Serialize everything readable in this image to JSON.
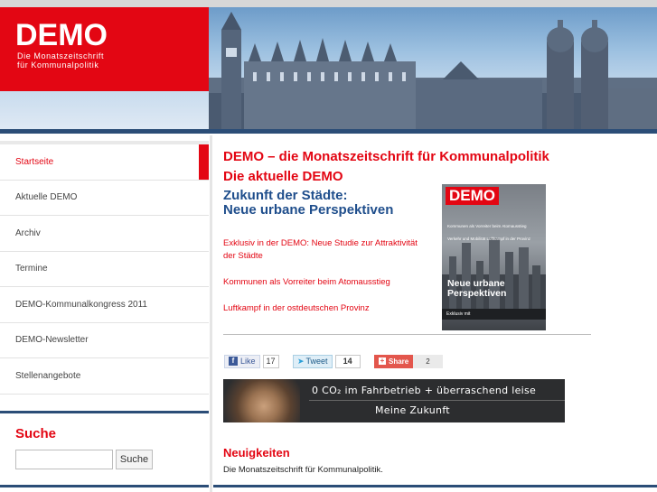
{
  "header": {
    "logo_title": "DEMO",
    "logo_subtitle_1": "Die Monatszeitschrift",
    "logo_subtitle_2": "für Kommunalpolitik"
  },
  "sidebar": {
    "items": [
      {
        "label": "Startseite",
        "active": true
      },
      {
        "label": "Aktuelle DEMO",
        "active": false
      },
      {
        "label": "Archiv",
        "active": false
      },
      {
        "label": "Termine",
        "active": false
      },
      {
        "label": "DEMO-Kommunalkongress 2011",
        "active": false
      },
      {
        "label": "DEMO-Newsletter",
        "active": false
      },
      {
        "label": "Stellenangebote",
        "active": false
      }
    ],
    "search": {
      "title": "Suche",
      "input_value": "",
      "button_label": "Suche"
    }
  },
  "main": {
    "title": "DEMO – die Monatszeitschrift für Kommunalpolitik",
    "subtitle": "Die aktuelle DEMO",
    "headline_1": "Zukunft der Städte:",
    "headline_2": "Neue urbane Perspektiven",
    "links": [
      "Exklusiv in der DEMO: Neue Studie zur Attraktivität der Städte",
      "Kommunen als Vorreiter beim Atomausstieg",
      "Luftkampf in der ostdeutschen Provinz"
    ],
    "cover": {
      "logo": "DEMO",
      "line_1": "Kommunen als Vorreiter beim Atomausstieg",
      "line_2": "Verkehr und Mobilität Luftkampf in der Provinz",
      "headline_1": "Neue urbane",
      "headline_2": "Perspektiven",
      "bar_text": "Exklusiv mit"
    },
    "social": {
      "like_label": "Like",
      "like_count": "17",
      "tweet_label": "Tweet",
      "tweet_count": "14",
      "share_label": "Share",
      "share_count": "2"
    },
    "banner": {
      "line_1": "0 CO₂ im Fahrbetrieb + überraschend leise",
      "line_2": "Meine Zukunft"
    },
    "news": {
      "title": "Neuigkeiten",
      "text": "Die Monatszeitschrift für Kommunalpolitik."
    }
  },
  "colors": {
    "brand_red": "#e30613",
    "navy": "#2b4d77",
    "headline_blue": "#1f4e8c"
  }
}
